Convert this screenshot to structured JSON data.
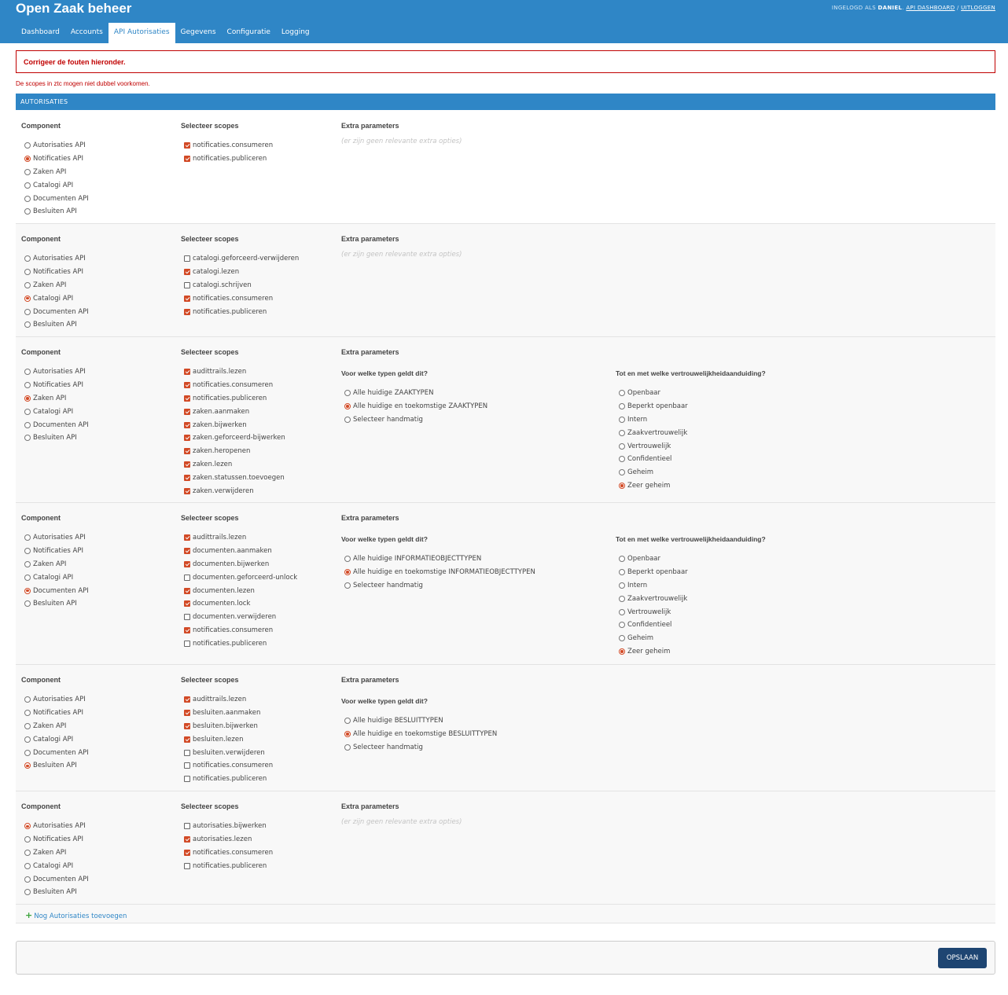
{
  "header": {
    "title": "Open Zaak beheer",
    "user_prefix": "INGELOGD ALS",
    "username": "DANIEL",
    "link_dashboard": "API DASHBOARD",
    "separator": "/",
    "link_logout": "UITLOGGEN"
  },
  "nav": {
    "tabs": [
      {
        "label": "Dashboard",
        "active": false
      },
      {
        "label": "Accounts",
        "active": false
      },
      {
        "label": "API Autorisaties",
        "active": true
      },
      {
        "label": "Gegevens",
        "active": false
      },
      {
        "label": "Configuratie",
        "active": false
      },
      {
        "label": "Logging",
        "active": false
      }
    ]
  },
  "errors": {
    "title": "Corrigeer de fouten hieronder.",
    "message": "De scopes in ztc mogen niet dubbel voorkomen."
  },
  "section_title": "AUTORISATIES",
  "labels": {
    "component": "Component",
    "scopes": "Selecteer scopes",
    "extra": "Extra parameters",
    "no_extra": "(er zijn geen relevante extra opties)",
    "types_question": "Voor welke typen geldt dit?",
    "vert_question": "Tot en met welke vertrouwelijkheidaanduiding?"
  },
  "components": [
    "Autorisaties API",
    "Notificaties API",
    "Zaken API",
    "Catalogi API",
    "Documenten API",
    "Besluiten API"
  ],
  "vertrouwelijkheid_options": [
    "Openbaar",
    "Beperkt openbaar",
    "Intern",
    "Zaakvertrouwelijk",
    "Vertrouwelijk",
    "Confidentieel",
    "Geheim",
    "Zeer geheim"
  ],
  "blocks": [
    {
      "component": "Notificaties API",
      "scopes": [
        {
          "label": "notificaties.consumeren",
          "checked": true
        },
        {
          "label": "notificaties.publiceren",
          "checked": true
        }
      ],
      "types": null,
      "vertrouwelijkheid": null
    },
    {
      "component": "Catalogi API",
      "scopes": [
        {
          "label": "catalogi.geforceerd-verwijderen",
          "checked": false
        },
        {
          "label": "catalogi.lezen",
          "checked": true
        },
        {
          "label": "catalogi.schrijven",
          "checked": false
        },
        {
          "label": "notificaties.consumeren",
          "checked": true
        },
        {
          "label": "notificaties.publiceren",
          "checked": true
        }
      ],
      "types": null,
      "vertrouwelijkheid": null
    },
    {
      "component": "Zaken API",
      "scopes": [
        {
          "label": "audittrails.lezen",
          "checked": true
        },
        {
          "label": "notificaties.consumeren",
          "checked": true
        },
        {
          "label": "notificaties.publiceren",
          "checked": true
        },
        {
          "label": "zaken.aanmaken",
          "checked": true
        },
        {
          "label": "zaken.bijwerken",
          "checked": true
        },
        {
          "label": "zaken.geforceerd-bijwerken",
          "checked": true
        },
        {
          "label": "zaken.heropenen",
          "checked": true
        },
        {
          "label": "zaken.lezen",
          "checked": true
        },
        {
          "label": "zaken.statussen.toevoegen",
          "checked": true
        },
        {
          "label": "zaken.verwijderen",
          "checked": true
        }
      ],
      "types": {
        "options": [
          "Alle huidige ZAAKTYPEN",
          "Alle huidige en toekomstige ZAAKTYPEN",
          "Selecteer handmatig"
        ],
        "selected": "Alle huidige en toekomstige ZAAKTYPEN"
      },
      "vertrouwelijkheid": "Zeer geheim"
    },
    {
      "component": "Documenten API",
      "scopes": [
        {
          "label": "audittrails.lezen",
          "checked": true
        },
        {
          "label": "documenten.aanmaken",
          "checked": true
        },
        {
          "label": "documenten.bijwerken",
          "checked": true
        },
        {
          "label": "documenten.geforceerd-unlock",
          "checked": false
        },
        {
          "label": "documenten.lezen",
          "checked": true
        },
        {
          "label": "documenten.lock",
          "checked": true
        },
        {
          "label": "documenten.verwijderen",
          "checked": false
        },
        {
          "label": "notificaties.consumeren",
          "checked": true
        },
        {
          "label": "notificaties.publiceren",
          "checked": false
        }
      ],
      "types": {
        "options": [
          "Alle huidige INFORMATIEOBJECTTYPEN",
          "Alle huidige en toekomstige INFORMATIEOBJECTTYPEN",
          "Selecteer handmatig"
        ],
        "selected": "Alle huidige en toekomstige INFORMATIEOBJECTTYPEN"
      },
      "vertrouwelijkheid": "Zeer geheim"
    },
    {
      "component": "Besluiten API",
      "scopes": [
        {
          "label": "audittrails.lezen",
          "checked": true
        },
        {
          "label": "besluiten.aanmaken",
          "checked": true
        },
        {
          "label": "besluiten.bijwerken",
          "checked": true
        },
        {
          "label": "besluiten.lezen",
          "checked": true
        },
        {
          "label": "besluiten.verwijderen",
          "checked": false
        },
        {
          "label": "notificaties.consumeren",
          "checked": false
        },
        {
          "label": "notificaties.publiceren",
          "checked": false
        }
      ],
      "types": {
        "options": [
          "Alle huidige BESLUITTYPEN",
          "Alle huidige en toekomstige BESLUITTYPEN",
          "Selecteer handmatig"
        ],
        "selected": "Alle huidige en toekomstige BESLUITTYPEN"
      },
      "vertrouwelijkheid": null
    },
    {
      "component": "Autorisaties API",
      "scopes": [
        {
          "label": "autorisaties.bijwerken",
          "checked": false
        },
        {
          "label": "autorisaties.lezen",
          "checked": true
        },
        {
          "label": "notificaties.consumeren",
          "checked": true
        },
        {
          "label": "notificaties.publiceren",
          "checked": false
        }
      ],
      "types": null,
      "vertrouwelijkheid": null
    }
  ],
  "add_link": "Nog Autorisaties toevoegen",
  "save_label": "OPSLAAN",
  "colors": {
    "header": "#2f86c6",
    "accent": "#d24a26",
    "error": "#c00000",
    "save_button": "#1e4572",
    "add_icon": "#3aa33a"
  }
}
